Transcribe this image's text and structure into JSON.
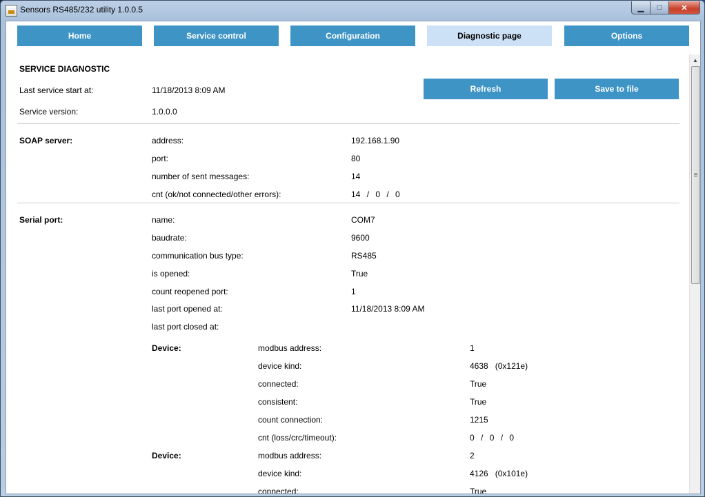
{
  "window": {
    "title": "Sensors RS485/232 utility  1.0.0.5"
  },
  "tabs": [
    {
      "label": "Home"
    },
    {
      "label": "Service control"
    },
    {
      "label": "Configuration"
    },
    {
      "label": "Diagnostic page",
      "active": true
    },
    {
      "label": "Options"
    }
  ],
  "actions": {
    "refresh": "Refresh",
    "save": "Save to file"
  },
  "service": {
    "heading": "SERVICE DIAGNOSTIC",
    "start_label": "Last service start at:",
    "start_value": "11/18/2013 8:09 AM",
    "version_label": "Service version:",
    "version_value": "1.0.0.0"
  },
  "soap": {
    "heading": "SOAP server:",
    "rows": [
      {
        "label": "address:",
        "value": "192.168.1.90"
      },
      {
        "label": "port:",
        "value": "80"
      },
      {
        "label": "number of sent messages:",
        "value": "14"
      },
      {
        "label": "cnt (ok/not connected/other errors):",
        "values": [
          "14",
          "0",
          "0"
        ]
      }
    ]
  },
  "serial": {
    "heading": "Serial port:",
    "rows": [
      {
        "label": "name:",
        "value": "COM7"
      },
      {
        "label": "baudrate:",
        "value": "9600"
      },
      {
        "label": "communication bus type:",
        "value": "RS485"
      },
      {
        "label": "is opened:",
        "value": "True"
      },
      {
        "label": "count reopened port:",
        "value": "1"
      },
      {
        "label": "last port opened at:",
        "value": "11/18/2013 8:09 AM"
      },
      {
        "label": "last port closed at:",
        "value": ""
      }
    ]
  },
  "devices": [
    {
      "heading": "Device:",
      "rows": [
        {
          "label": "modbus address:",
          "value": "1"
        },
        {
          "label": "device kind:",
          "value": "4638",
          "hex": "(0x121e)"
        },
        {
          "label": "connected:",
          "value": "True"
        },
        {
          "label": "consistent:",
          "value": "True"
        },
        {
          "label": "count connection:",
          "value": "1215"
        },
        {
          "label": "cnt (loss/crc/timeout):",
          "values": [
            "0",
            "0",
            "0"
          ]
        }
      ]
    },
    {
      "heading": "Device:",
      "rows": [
        {
          "label": "modbus address:",
          "value": "2"
        },
        {
          "label": "device kind:",
          "value": "4126",
          "hex": "(0x101e)"
        },
        {
          "label": "connected:",
          "value": "True"
        }
      ]
    }
  ],
  "icons": {
    "app": "app-icon",
    "minimize": "minimize-icon",
    "maximize": "maximize-icon",
    "close": "close-icon",
    "scroll_up": "chevron-up-icon",
    "grip": "grip-icon"
  },
  "colors": {
    "tab": "#3f94c6",
    "tab_active": "#cde1f6",
    "button": "#3f94c6"
  }
}
